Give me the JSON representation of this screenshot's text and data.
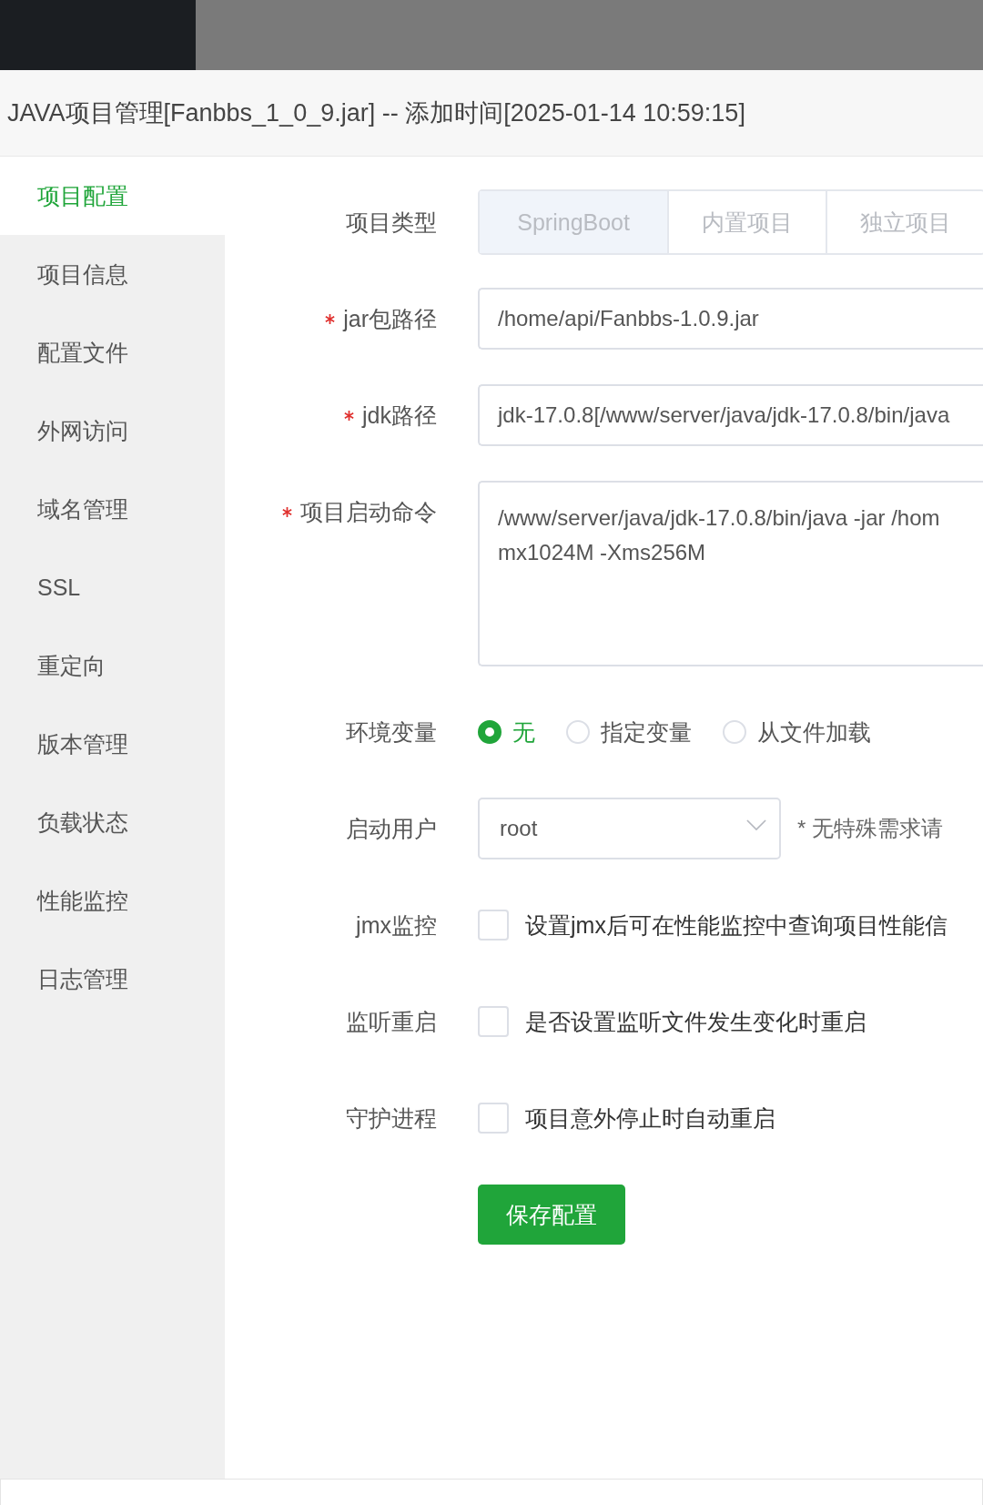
{
  "title": "JAVA项目管理[Fanbbs_1_0_9.jar] -- 添加时间[2025-01-14 10:59:15]",
  "sidebar": {
    "items": [
      {
        "label": "项目配置",
        "selected": true
      },
      {
        "label": "项目信息",
        "selected": false
      },
      {
        "label": "配置文件",
        "selected": false
      },
      {
        "label": "外网访问",
        "selected": false
      },
      {
        "label": "域名管理",
        "selected": false
      },
      {
        "label": "SSL",
        "selected": false
      },
      {
        "label": "重定向",
        "selected": false
      },
      {
        "label": "版本管理",
        "selected": false
      },
      {
        "label": "负载状态",
        "selected": false
      },
      {
        "label": "性能监控",
        "selected": false
      },
      {
        "label": "日志管理",
        "selected": false
      }
    ]
  },
  "form": {
    "fields": [
      {
        "kind": "segmented",
        "label": "项目类型",
        "required": false,
        "options": [
          {
            "label": "SpringBoot",
            "selected": true
          },
          {
            "label": "内置项目",
            "selected": false
          },
          {
            "label": "独立项目",
            "selected": false
          }
        ]
      },
      {
        "kind": "text",
        "label": "jar包路径",
        "required": true,
        "value": "/home/api/Fanbbs-1.0.9.jar"
      },
      {
        "kind": "text",
        "label": "jdk路径",
        "required": true,
        "value": "jdk-17.0.8[/www/server/java/jdk-17.0.8/bin/java"
      },
      {
        "kind": "textarea",
        "label": "项目启动命令",
        "required": true,
        "value_lines": [
          "/www/server/java/jdk-17.0.8/bin/java -jar /hom",
          "mx1024M -Xms256M"
        ]
      },
      {
        "kind": "radio",
        "label": "环境变量",
        "required": false,
        "options": [
          {
            "label": "无",
            "selected": true
          },
          {
            "label": "指定变量",
            "selected": false
          },
          {
            "label": "从文件加载",
            "selected": false
          }
        ]
      },
      {
        "kind": "select",
        "label": "启动用户",
        "required": false,
        "value": "root",
        "hint": "* 无特殊需求请"
      },
      {
        "kind": "checkbox",
        "label": "jmx监控",
        "required": false,
        "checked": false,
        "text": "设置jmx后可在性能监控中查询项目性能信"
      },
      {
        "kind": "checkbox",
        "label": "监听重启",
        "required": false,
        "checked": false,
        "text": "是否设置监听文件发生变化时重启"
      },
      {
        "kind": "checkbox",
        "label": "守护进程",
        "required": false,
        "checked": false,
        "text": "项目意外停止时自动重启"
      }
    ],
    "save_button": "保存配置"
  }
}
